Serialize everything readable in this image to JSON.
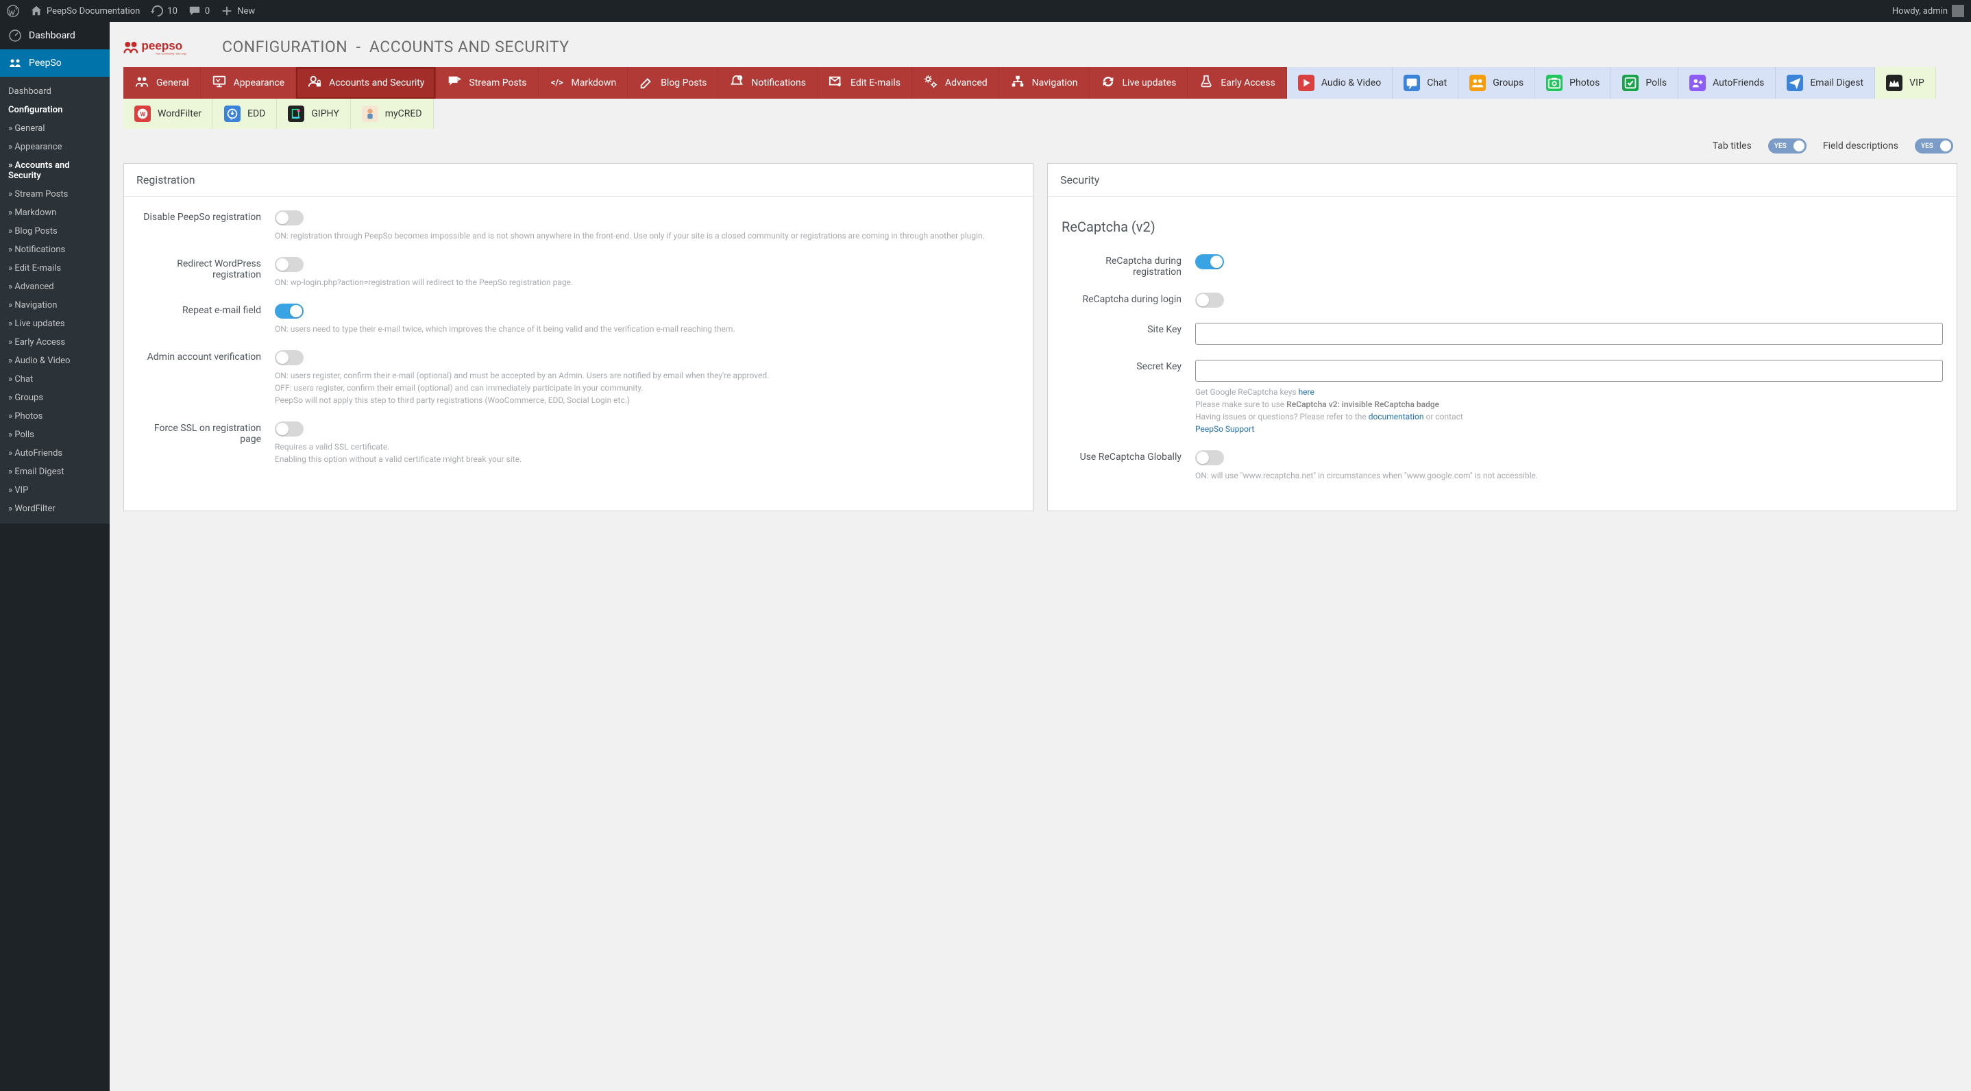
{
  "admin_bar": {
    "site_title": "PeepSo Documentation",
    "updates": "10",
    "comments": "0",
    "new": "New",
    "howdy": "Howdy, admin"
  },
  "sidebar": {
    "dashboard": "Dashboard",
    "peepso": "PeepSo",
    "sub_dashboard": "Dashboard",
    "configuration": "Configuration",
    "items": [
      "General",
      "Appearance",
      "Accounts and Security",
      "Stream Posts",
      "Markdown",
      "Blog Posts",
      "Notifications",
      "Edit E-mails",
      "Advanced",
      "Navigation",
      "Live updates",
      "Early Access",
      "Audio & Video",
      "Chat",
      "Groups",
      "Photos",
      "Polls",
      "AutoFriends",
      "Email Digest",
      "VIP",
      "WordFilter"
    ]
  },
  "page": {
    "title_a": "CONFIGURATION",
    "title_sep": "-",
    "title_b": "ACCOUNTS  AND  SECURITY"
  },
  "tabs": {
    "row1": [
      "General",
      "Appearance",
      "Accounts and Security",
      "Stream Posts",
      "Markdown",
      "Blog Posts",
      "Notifications",
      "Edit E-mails",
      "Advanced"
    ],
    "row1b": [
      "Navigation",
      "Live updates",
      "Early Access"
    ],
    "row2": [
      "Audio & Video",
      "Chat",
      "Groups",
      "Photos",
      "Polls",
      "AutoFriends",
      "Email Digest"
    ],
    "row3": [
      "VIP",
      "WordFilter",
      "EDD",
      "GIPHY",
      "myCRED"
    ]
  },
  "toggles_row": {
    "tab_titles": "Tab titles",
    "field_desc": "Field descriptions",
    "yes": "YES"
  },
  "registration": {
    "header": "Registration",
    "disable_label": "Disable PeepSo registration",
    "disable_desc": "ON: registration through PeepSo becomes impossible and is not shown anywhere in the front-end. Use only if your site is a closed community or registrations are coming in through another plugin.",
    "redirect_label": "Redirect WordPress registration",
    "redirect_desc": "ON: wp-login.php?action=registration will redirect to the PeepSo registration page.",
    "repeat_label": "Repeat e-mail field",
    "repeat_desc": "ON: users need to type their e-mail twice, which improves the chance of it being valid and the verification e-mail reaching them.",
    "admin_label": "Admin account verification",
    "admin_desc_1": "ON: users register, confirm their e-mail (optional) and must be accepted by an Admin. Users are notified by email when they're approved.",
    "admin_desc_2": "OFF: users register, confirm their email (optional) and can immediately participate in your community.",
    "admin_desc_3": "PeepSo will not apply this step to third party registrations (WooCommerce, EDD, Social Login etc.)",
    "ssl_label": "Force SSL on registration page",
    "ssl_desc_1": "Requires a valid SSL certificate.",
    "ssl_desc_2": "Enabling this option without a valid certificate might break your site."
  },
  "security": {
    "header": "Security",
    "recaptcha_title": "ReCaptcha (v2)",
    "recaptcha_reg": "ReCaptcha during registration",
    "recaptcha_login": "ReCaptcha during login",
    "site_key": "Site Key",
    "secret_key": "Secret Key",
    "desc_1a": "Get Google ReCaptcha keys ",
    "desc_1_link": "here",
    "desc_2a": "Please make sure to use ",
    "desc_2_strong": "ReCaptcha v2: invisible ReCaptcha badge",
    "desc_3a": "Having issues or questions? Please refer to the ",
    "desc_3_link": "documentation",
    "desc_3b": " or contact ",
    "desc_3_link2": "PeepSo Support",
    "global_label": "Use ReCaptcha Globally",
    "global_desc": "ON: will use \"www.recaptcha.net\" in circumstances when \"www.google.com\" is not accessible."
  }
}
